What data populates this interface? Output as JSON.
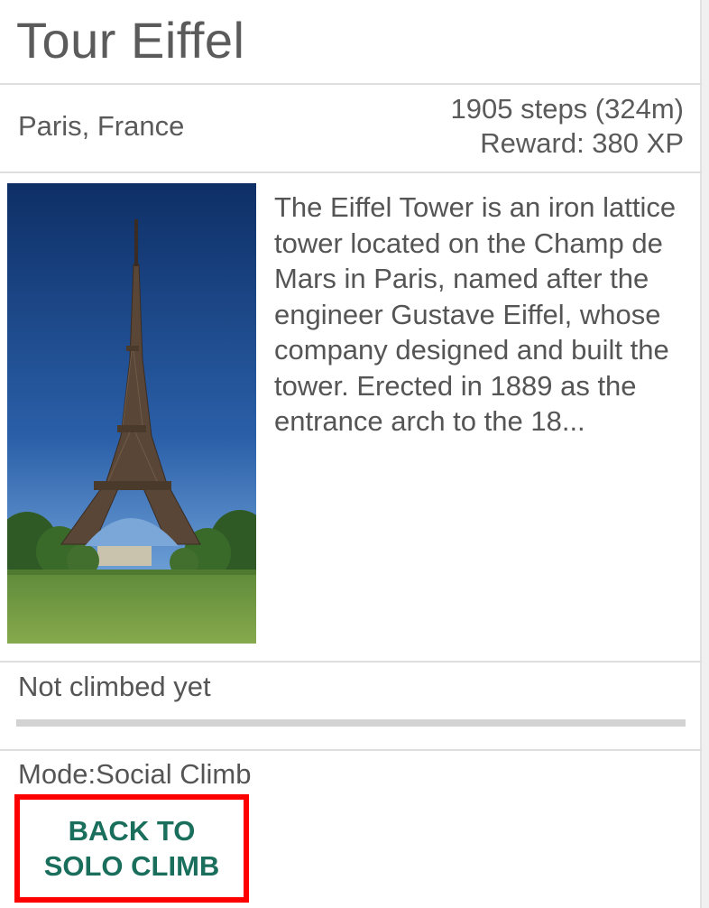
{
  "landmark": {
    "title": "Tour Eiffel",
    "location": "Paris, France",
    "steps": "1905 steps (324m)",
    "reward": "Reward: 380 XP",
    "description": "The Eiffel Tower is an iron lattice tower located on the Champ de Mars in Paris, named after the engineer Gustave Eiffel, whose company designed and built the tower. Erected in 1889 as the entrance arch to the 18...",
    "photo_subject": "eiffel-tower-photo"
  },
  "progress": {
    "status": "Not climbed yet",
    "fraction": 0.0
  },
  "mode": {
    "label": "Mode:Social Climb",
    "button_label": "BACK TO\nSOLO CLIMB"
  },
  "colors": {
    "accent": "#1a6e5c",
    "highlight_border": "#ff0000",
    "progress_track": "#d3d3d3"
  }
}
